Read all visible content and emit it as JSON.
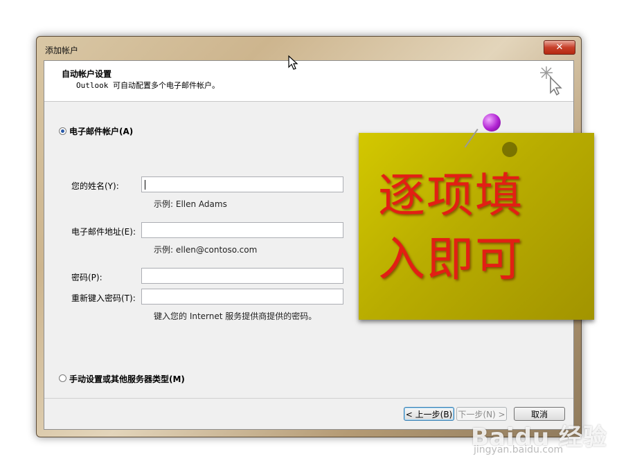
{
  "window": {
    "title": "添加帐户",
    "close_glyph": "✕"
  },
  "header": {
    "title": "自动帐户设置",
    "subtitle": "Outlook 可自动配置多个电子邮件帐户。",
    "icon": "wizard-sparkle-cursor-icon"
  },
  "email_option": {
    "label": "电子邮件帐户(A)",
    "selected": true
  },
  "form": {
    "name_label": "您的姓名(Y):",
    "name_value": "",
    "name_hint": "示例: Ellen Adams",
    "email_label": "电子邮件地址(E):",
    "email_value": "",
    "email_hint": "示例: ellen@contoso.com",
    "password_label": "密码(P):",
    "password_value": "",
    "retype_label": "重新键入密码(T):",
    "retype_value": "",
    "password_hint": "键入您的 Internet 服务提供商提供的密码。"
  },
  "manual_option": {
    "label": "手动设置或其他服务器类型(M)",
    "selected": false
  },
  "buttons": {
    "back": "< 上一步(B)",
    "next": "下一步(N) >",
    "cancel": "取消"
  },
  "note": {
    "line1": "逐项填",
    "line2": "入即可"
  },
  "watermark": {
    "main": "Baidu 经验",
    "sub": "jingyan.baidu.com"
  },
  "colors": {
    "note_bg": "#c4b800",
    "note_text": "#e21f14",
    "pin": "#b022d2"
  }
}
